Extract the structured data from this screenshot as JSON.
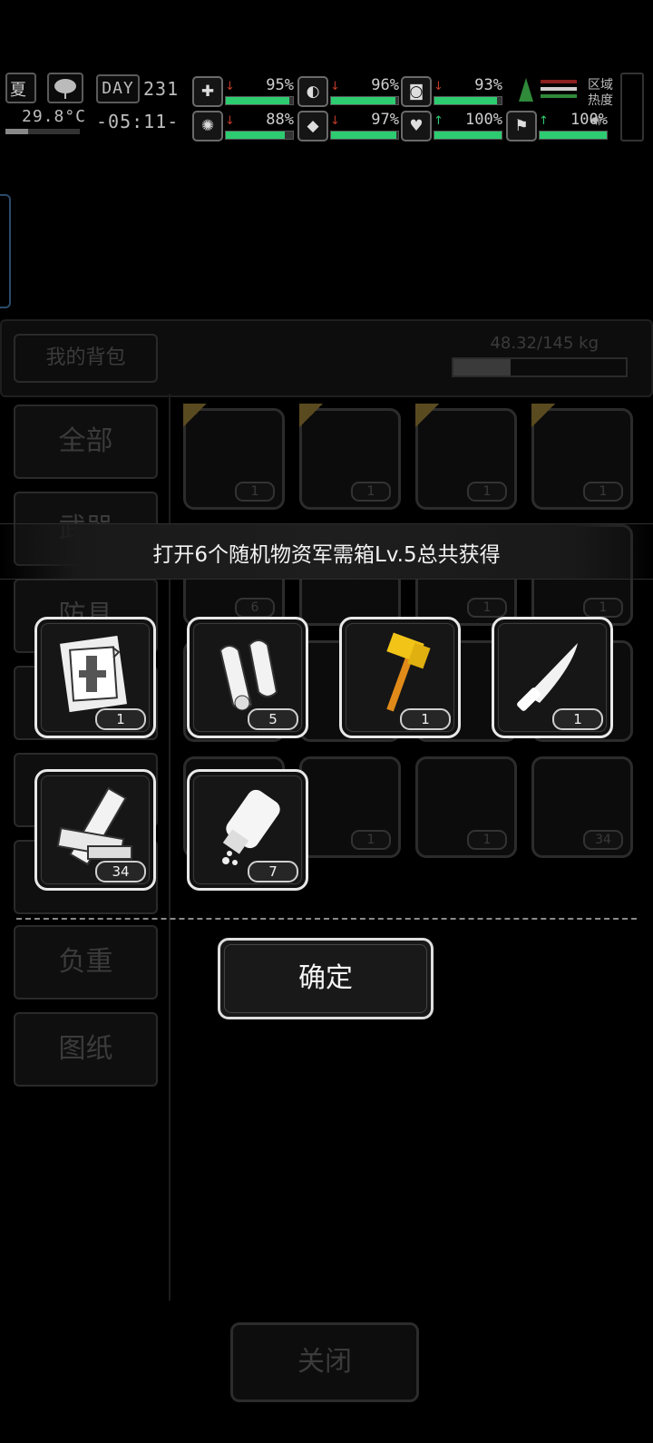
{
  "hud": {
    "season": "夏",
    "temperature": "29.8°C",
    "day_label": "DAY",
    "day_number": "231",
    "clock": "-05:11-",
    "zone_heat": "区域热度",
    "stats": [
      {
        "icon": "medkit-icon",
        "glyph": "✚",
        "arrow": "↓",
        "arrow_color": "#c0392b",
        "value": "95%",
        "level": 0.95,
        "color": "#2ecc71"
      },
      {
        "icon": "stomach-icon",
        "glyph": "◐",
        "arrow": "↓",
        "arrow_color": "#c0392b",
        "value": "96%",
        "level": 0.96,
        "color": "#2ecc71"
      },
      {
        "icon": "mask-icon",
        "glyph": "◙",
        "arrow": "↓",
        "arrow_color": "#c0392b",
        "value": "93%",
        "level": 0.93,
        "color": "#2ecc71"
      },
      {
        "icon": "brain-icon",
        "glyph": "✺",
        "arrow": "↓",
        "arrow_color": "#c0392b",
        "value": "88%",
        "level": 0.88,
        "color": "#2ecc71"
      },
      {
        "icon": "water-drop-icon",
        "glyph": "◆",
        "arrow": "↓",
        "arrow_color": "#c0392b",
        "value": "97%",
        "level": 0.97,
        "color": "#2ecc71"
      },
      {
        "icon": "heart-icon",
        "glyph": "♥",
        "arrow": "↑",
        "arrow_color": "#2ecc71",
        "value": "100%",
        "level": 1.0,
        "color": "#2ecc71"
      },
      {
        "icon": "stamina-icon",
        "glyph": "⚑",
        "arrow": "↑",
        "arrow_color": "#2ecc71",
        "value": "100%",
        "level": 1.0,
        "color": "#2ecc71"
      }
    ]
  },
  "backpack": {
    "title": "我的背包",
    "weight": "48.32/145 kg",
    "weight_level": 0.33,
    "tabs": [
      "全部",
      "武器",
      "防具",
      "",
      "",
      "",
      "负重",
      "图纸"
    ],
    "slot_counts": [
      "1",
      "1",
      "1",
      "1",
      "6",
      "",
      "1",
      "1",
      "",
      "",
      "",
      "",
      "",
      "1",
      "1",
      "34"
    ],
    "close_label": "关闭"
  },
  "popup": {
    "title": "打开6个随机物资军需箱Lv.5总共获得",
    "items": [
      {
        "name": "blueprint-icon",
        "count": "1"
      },
      {
        "name": "cloth-roll-icon",
        "count": "5"
      },
      {
        "name": "golden-hammer-icon",
        "count": "1"
      },
      {
        "name": "combat-knife-icon",
        "count": "1"
      },
      {
        "name": "wood-planks-icon",
        "count": "34"
      },
      {
        "name": "pill-bottle-icon",
        "count": "7"
      }
    ],
    "confirm_label": "确定"
  }
}
